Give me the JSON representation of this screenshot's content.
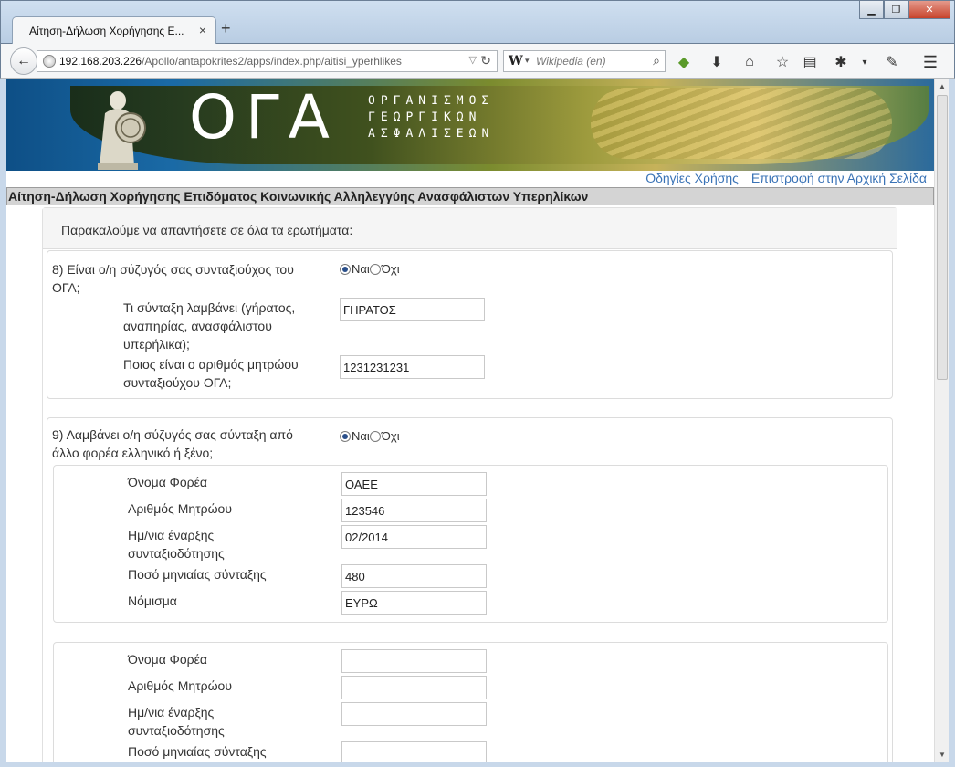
{
  "browser": {
    "tab_title": "Αίτηση-Δήλωση Χορήγησης Ε...",
    "url_host": "192.168.203.226",
    "url_path": "/Apollo/antapokrites2/apps/index.php/aitisi_yperhlikes",
    "search_placeholder": "Wikipedia (en)",
    "search_engine_glyph": "W",
    "icons": [
      "back-arrow",
      "globe",
      "reload",
      "search",
      "feedly",
      "download",
      "home",
      "bookmark-star",
      "reading-list",
      "bug",
      "menu-dropdown",
      "notes",
      "hamburger-menu"
    ]
  },
  "banner": {
    "logo": "ΟΓΑ",
    "org_lines": [
      "ΟΡΓΑΝΙΣΜΟΣ",
      "ΓΕΩΡΓΙΚΩΝ",
      "ΑΣΦΑΛΙΣΕΩΝ"
    ]
  },
  "toplinks": {
    "help": "Οδηγίες Χρήσης",
    "home": "Επιστροφή στην Αρχική Σελίδα"
  },
  "page_heading": "Αίτηση-Δήλωση Χορήγησης Επιδόματος Κοινωνικής Αλληλεγγύης Ανασφάλιστων Υπερηλίκων",
  "intro": "Παρακαλούμε να απαντήσετε σε όλα τα ερωτήματα:",
  "q8": {
    "label_line1": "8) Είναι ο/η σύζυγός σας συνταξιούχος του",
    "label_line2": "ΟΓΑ;",
    "yes": "Ναι",
    "no": "Όχι",
    "selected": "yes",
    "pension_label_line1": "Τι σύνταξη λαμβάνει (γήρατος,",
    "pension_label_line2": "αναπηρίας, ανασφάλιστου",
    "pension_label_line3": "υπερήλικα);",
    "pension_value": "ΓΗΡΑΤΟΣ",
    "regno_label_line1": "Ποιος είναι ο αριθμός μητρώου",
    "regno_label_line2": "συνταξιούχου ΟΓΑ;",
    "regno_value": "1231231231"
  },
  "q9": {
    "label_line1": "9) Λαμβάνει ο/η σύζυγός σας σύνταξη από",
    "label_line2": "άλλο φορέα ελληνικό ή ξένο;",
    "yes": "Ναι",
    "no": "Όχι",
    "selected": "yes",
    "field_labels": {
      "org_name": "Όνομα Φορέα",
      "reg_no": "Αριθμός Μητρώου",
      "start_date_line1": "Ημ/νια έναρξης",
      "start_date_line2": "συνταξιοδότησης",
      "monthly_amount": "Ποσό μηνιαίας σύνταξης",
      "currency": "Νόμισμα"
    },
    "entries": [
      {
        "org_name": "ΟΑΕΕ",
        "reg_no": "123546",
        "start_date": "02/2014",
        "monthly_amount": "480",
        "currency": "ΕΥΡΩ"
      },
      {
        "org_name": "",
        "reg_no": "",
        "start_date": "",
        "monthly_amount": "",
        "currency": ""
      }
    ]
  }
}
